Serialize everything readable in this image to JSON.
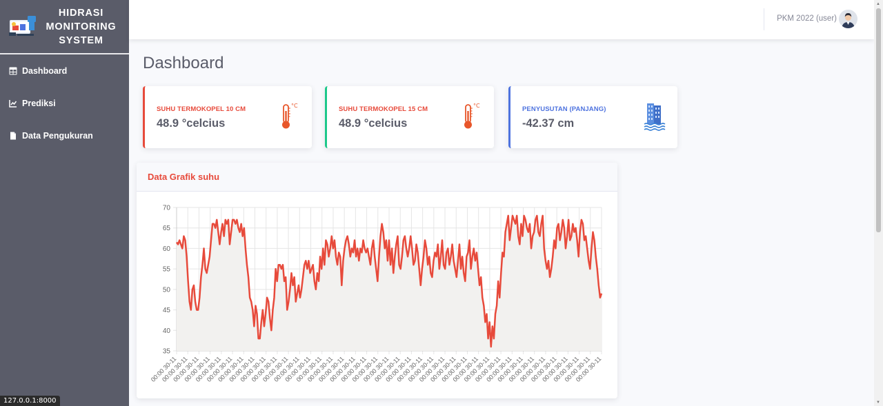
{
  "brand": {
    "line1": "HIDRASI",
    "line2": "MONITORING",
    "line3": "SYSTEM"
  },
  "sidebar": {
    "items": [
      {
        "label": "Dashboard",
        "icon": "table-icon"
      },
      {
        "label": "Prediksi",
        "icon": "chart-line-icon"
      },
      {
        "label": "Data Pengukuran",
        "icon": "file-icon"
      }
    ]
  },
  "status_url": "127.0.0.1:8000",
  "topbar": {
    "user_name": "PKM 2022 (user)"
  },
  "page": {
    "title": "Dashboard"
  },
  "cards": [
    {
      "label": "SUHU TERMOKOPEL 10 CM",
      "value": "48.9 °celcius",
      "color": "#e74a3b",
      "icon": "thermometer-icon"
    },
    {
      "label": "SUHU TERMOKOPEL 15 CM",
      "value": "48.9 °celcius",
      "color": "#1cc88a",
      "icon": "thermometer-icon"
    },
    {
      "label": "PENYUSUTAN (PANJANG)",
      "value": "-42.37 cm",
      "color": "#4e73df",
      "icon": "building-water-icon"
    }
  ],
  "chart": {
    "title": "Data Grafik suhu"
  },
  "chart_data": {
    "type": "line",
    "ylim": [
      35,
      70
    ],
    "yticks": [
      35,
      40,
      45,
      50,
      55,
      60,
      65,
      70
    ],
    "xtick_label": "00:00 30-11",
    "xtick_count": 39,
    "line_color": "#e74a3b",
    "fill_color": "#f2f1ef",
    "series": [
      {
        "values": [
          61.5,
          61,
          62,
          61,
          60,
          63,
          62,
          58,
          52,
          47,
          45,
          50,
          51,
          47,
          45,
          45,
          48,
          53,
          56,
          60,
          55,
          54,
          56,
          58,
          62,
          66,
          66,
          65,
          67,
          64,
          61,
          64,
          66,
          63,
          67,
          66,
          67,
          61,
          64,
          67,
          67,
          66,
          67,
          65,
          64,
          66,
          63,
          65,
          60,
          56,
          53,
          48,
          47,
          45,
          41,
          46,
          44,
          38,
          38,
          42,
          45,
          41,
          44,
          48,
          47,
          43,
          40,
          45,
          48,
          55,
          52,
          56,
          56,
          55,
          56,
          52,
          53,
          45,
          47,
          50,
          54,
          51,
          53,
          47,
          49,
          51,
          48,
          50,
          53,
          56,
          57,
          55,
          57,
          54,
          55,
          56,
          52,
          50,
          54,
          52,
          58,
          55,
          60,
          56,
          62,
          61,
          58,
          60,
          63,
          60,
          62,
          58,
          56,
          59,
          58,
          51,
          57,
          60,
          62,
          63,
          61,
          58,
          60,
          59,
          62,
          58,
          60,
          57,
          60,
          59,
          62,
          60,
          59,
          60,
          58,
          56,
          60,
          62,
          58,
          55,
          52,
          58,
          63,
          66,
          64,
          60,
          62,
          57,
          62,
          56,
          60,
          54,
          58,
          61,
          63,
          56,
          55,
          58,
          62,
          63,
          60,
          58,
          60,
          63,
          60,
          56,
          57,
          61,
          59,
          55,
          51,
          55,
          58,
          62,
          60,
          56,
          58,
          54,
          53,
          57,
          59,
          58,
          61,
          55,
          58,
          62,
          56,
          55,
          59,
          60,
          56,
          58,
          61,
          57,
          55,
          53,
          57,
          61,
          55,
          58,
          54,
          52,
          58,
          59,
          62,
          55,
          58,
          60,
          57,
          59,
          55,
          51,
          53,
          48,
          46,
          42,
          44,
          38,
          42,
          36,
          41,
          38,
          44,
          46,
          52,
          48,
          54,
          59,
          58,
          64,
          66,
          68,
          62,
          65,
          68,
          67,
          66,
          68,
          63,
          61,
          66,
          63,
          68,
          67,
          65,
          64,
          66,
          60,
          63,
          64,
          67,
          68,
          64,
          63,
          66,
          68,
          60,
          57,
          55,
          57,
          53,
          55,
          58,
          62,
          60,
          65,
          66,
          62,
          64,
          67,
          65,
          60,
          63,
          67,
          62,
          63,
          66,
          64,
          65,
          62,
          58,
          64,
          67,
          66,
          62,
          63,
          60,
          57,
          55,
          60,
          64,
          62,
          58,
          55,
          51,
          48,
          49
        ]
      }
    ]
  }
}
